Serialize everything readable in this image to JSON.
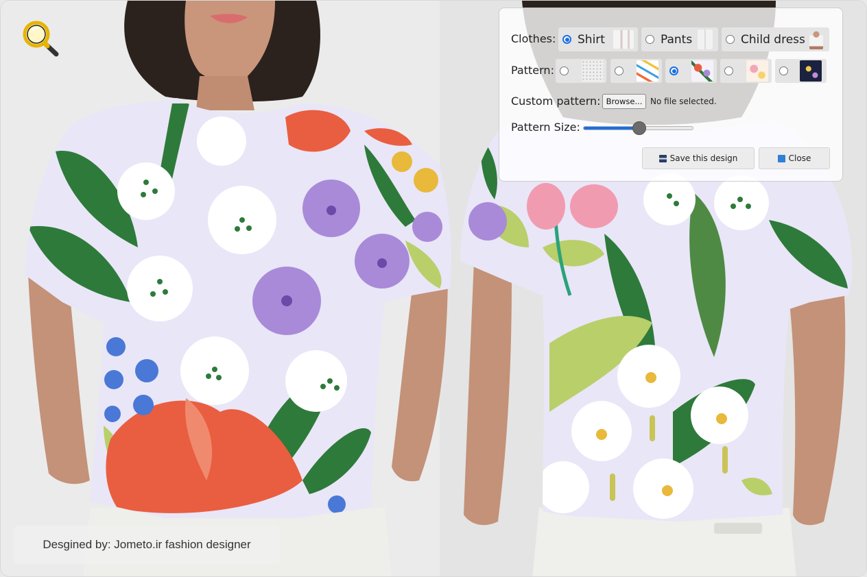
{
  "colors": {
    "accent": "#1a6fe0",
    "shirt_base": "#e9e6f7",
    "leaf_dark": "#2e7a3a",
    "leaf_light": "#b9cf6a",
    "flower_purple": "#a98ad8",
    "flower_red": "#e95e40",
    "flower_white": "#ffffff",
    "dot_blue": "#4a78d6",
    "flower_pink": "#f19bb0",
    "flower_yellow": "#e8b93a"
  },
  "toolbar": {
    "magnifier_icon": "magnifier-icon"
  },
  "panel": {
    "clothes_label": "Clothes:",
    "clothes_options": [
      {
        "label": "Shirt",
        "checked": true,
        "thumb_icon": "shirt-thumbnail"
      },
      {
        "label": "Pants",
        "checked": false,
        "thumb_icon": "pants-thumbnail"
      },
      {
        "label": "Child dress",
        "checked": false,
        "thumb_icon": "child-dress-thumbnail"
      }
    ],
    "pattern_label": "Pattern:",
    "pattern_options": [
      {
        "checked": false,
        "thumb_icon": "dots-pattern-thumbnail"
      },
      {
        "checked": false,
        "thumb_icon": "confetti-pattern-thumbnail"
      },
      {
        "checked": true,
        "thumb_icon": "floral-pattern-thumbnail"
      },
      {
        "checked": false,
        "thumb_icon": "pastel-floral-pattern-thumbnail"
      },
      {
        "checked": false,
        "thumb_icon": "night-pattern-thumbnail"
      }
    ],
    "custom_pattern_label": "Custom pattern:",
    "browse_label": "Browse...",
    "file_status": "No file selected.",
    "pattern_size_label": "Pattern Size:",
    "pattern_size_level": 0.5,
    "save_label": "Save this design",
    "save_icon": "floppy-disk-icon",
    "close_label": "Close",
    "close_icon": "close-arrow-icon"
  },
  "footer": {
    "credit": "Desgined by: Jometo.ir fashion designer"
  }
}
